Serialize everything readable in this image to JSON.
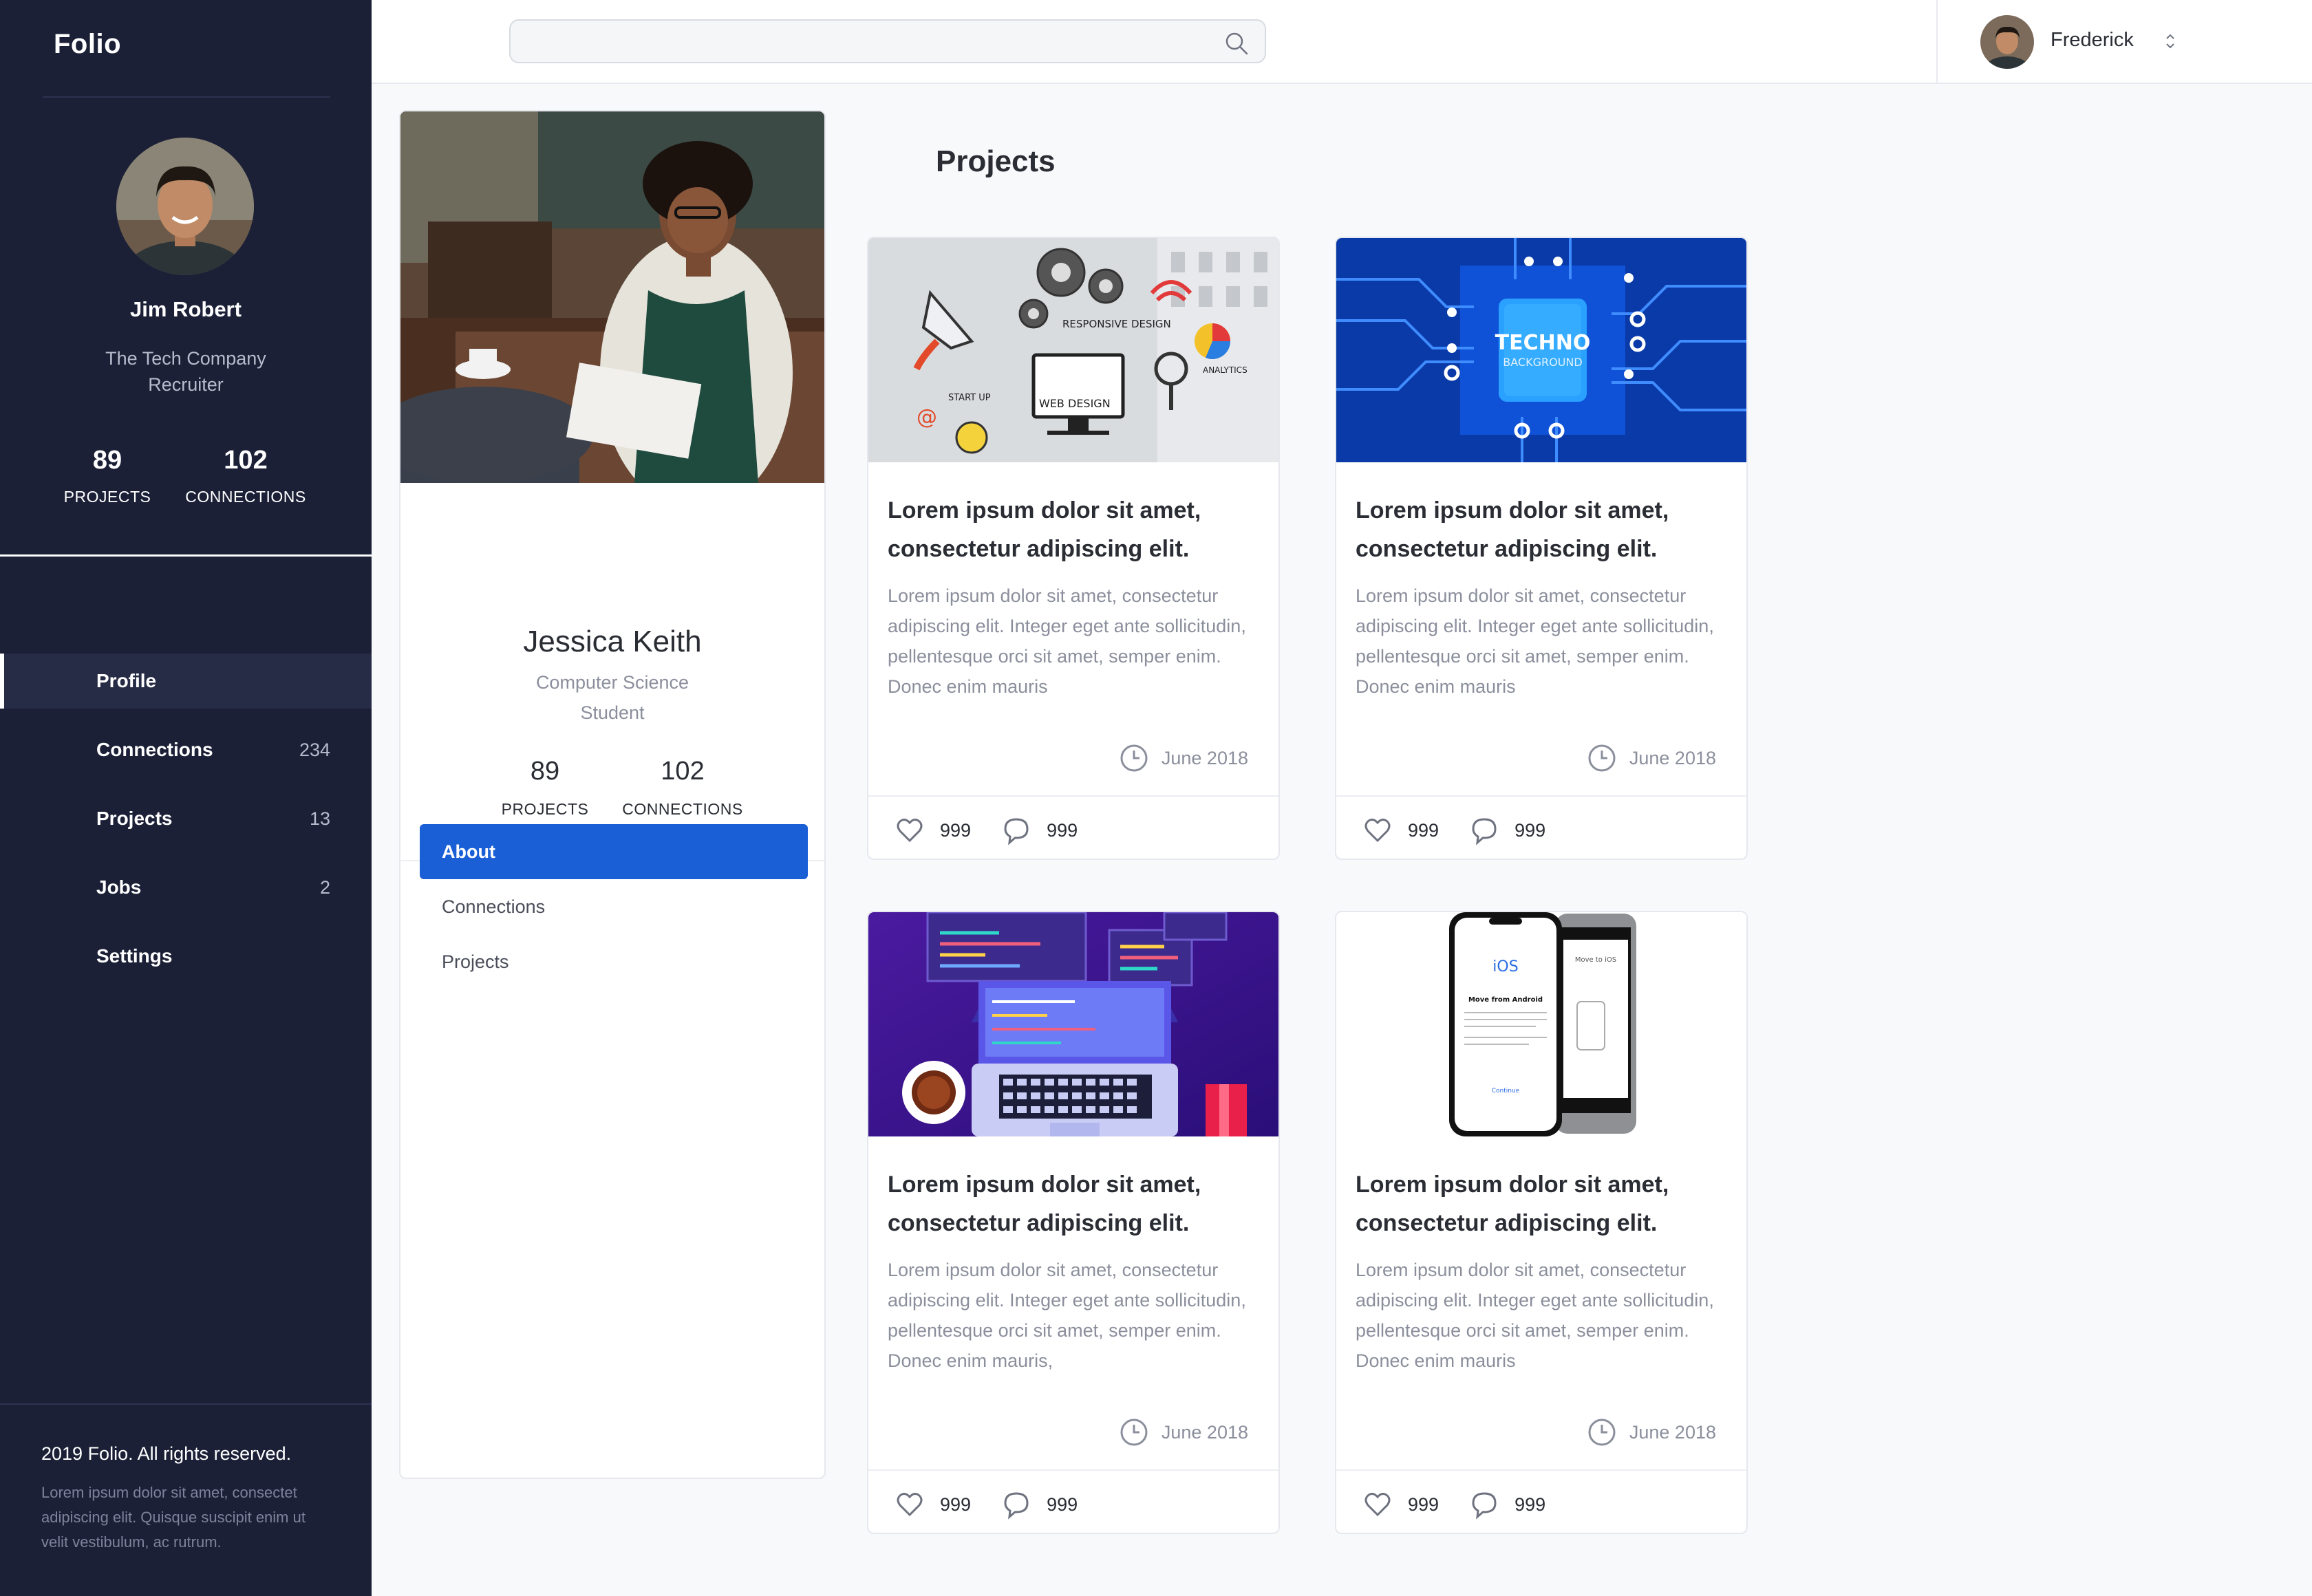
{
  "brand": "Folio",
  "sidebar": {
    "user": {
      "name": "Jim Robert",
      "company": "The Tech Company",
      "role": "Recruiter",
      "stats": [
        {
          "value": "89",
          "label": "PROJECTS"
        },
        {
          "value": "102",
          "label": "CONNECTIONS"
        }
      ]
    },
    "nav": [
      {
        "label": "Profile",
        "count": ""
      },
      {
        "label": "Connections",
        "count": "234"
      },
      {
        "label": "Projects",
        "count": "13"
      },
      {
        "label": "Jobs",
        "count": "2"
      },
      {
        "label": "Settings",
        "count": ""
      }
    ],
    "footer": {
      "copyright": "2019 Folio. All rights reserved.",
      "description": "Lorem ipsum dolor sit amet, consectet adipiscing elit. Quisque suscipit enim ut velit vestibulum, ac rutrum."
    }
  },
  "topbar": {
    "search": {
      "value": "",
      "placeholder": ""
    },
    "user_name": "Frederick"
  },
  "profile": {
    "name": "Jessica Keith",
    "field": "Computer Science",
    "role": "Student",
    "stats": [
      {
        "value": "89",
        "label": "PROJECTS"
      },
      {
        "value": "102",
        "label": "CONNECTIONS"
      }
    ],
    "tabs": [
      "About",
      "Connections",
      "Projects"
    ],
    "active_tab": "About"
  },
  "projects": {
    "title": "Projects",
    "cards": [
      {
        "image": "web-design-illustration",
        "title": "Lorem ipsum dolor sit amet, consectetur adipiscing elit.",
        "description": "Lorem ipsum dolor sit amet, consectetur adipiscing elit. Integer eget ante sollicitudin, pellentesque orci sit amet, semper enim. Donec enim mauris",
        "date": "June 2018",
        "likes": "999",
        "comments": "999",
        "image_text": [
          "RESPONSIVE DESIGN",
          "ANALYTICS",
          "START UP",
          "WEB DESIGN"
        ]
      },
      {
        "image": "techno-circuit-background",
        "title": "Lorem ipsum dolor sit amet, consectetur adipiscing elit.",
        "description": "Lorem ipsum dolor sit amet, consectetur adipiscing elit. Integer eget ante sollicitudin, pellentesque orci sit amet, semper enim. Donec enim mauris",
        "date": "June 2018",
        "likes": "999",
        "comments": "999",
        "image_text": [
          "TECHNO",
          "BACKGROUND"
        ]
      },
      {
        "image": "laptop-code-illustration",
        "title": "Lorem ipsum dolor sit amet, consectetur adipiscing elit.",
        "description": "Lorem ipsum dolor sit amet, consectetur adipiscing elit. Integer eget ante sollicitudin, pellentesque orci sit amet, semper enim. Donec enim mauris,",
        "date": "June 2018",
        "likes": "999",
        "comments": "999"
      },
      {
        "image": "move-to-ios-phones",
        "title": "Lorem ipsum dolor sit amet, consectetur adipiscing elit.",
        "description": "Lorem ipsum dolor sit amet, consectetur adipiscing elit. Integer eget ante sollicitudin, pellentesque orci sit amet, semper enim. Donec enim mauris",
        "date": "June 2018",
        "likes": "999",
        "comments": "999",
        "image_text": [
          "iOS",
          "Move from Android",
          "Move to iOS",
          "Continue"
        ]
      }
    ]
  },
  "colors": {
    "sidebar_bg": "#1b2037",
    "accent": "#1a5fd6",
    "page_bg": "#f8f9fb",
    "muted_text": "#8b8f9c"
  }
}
